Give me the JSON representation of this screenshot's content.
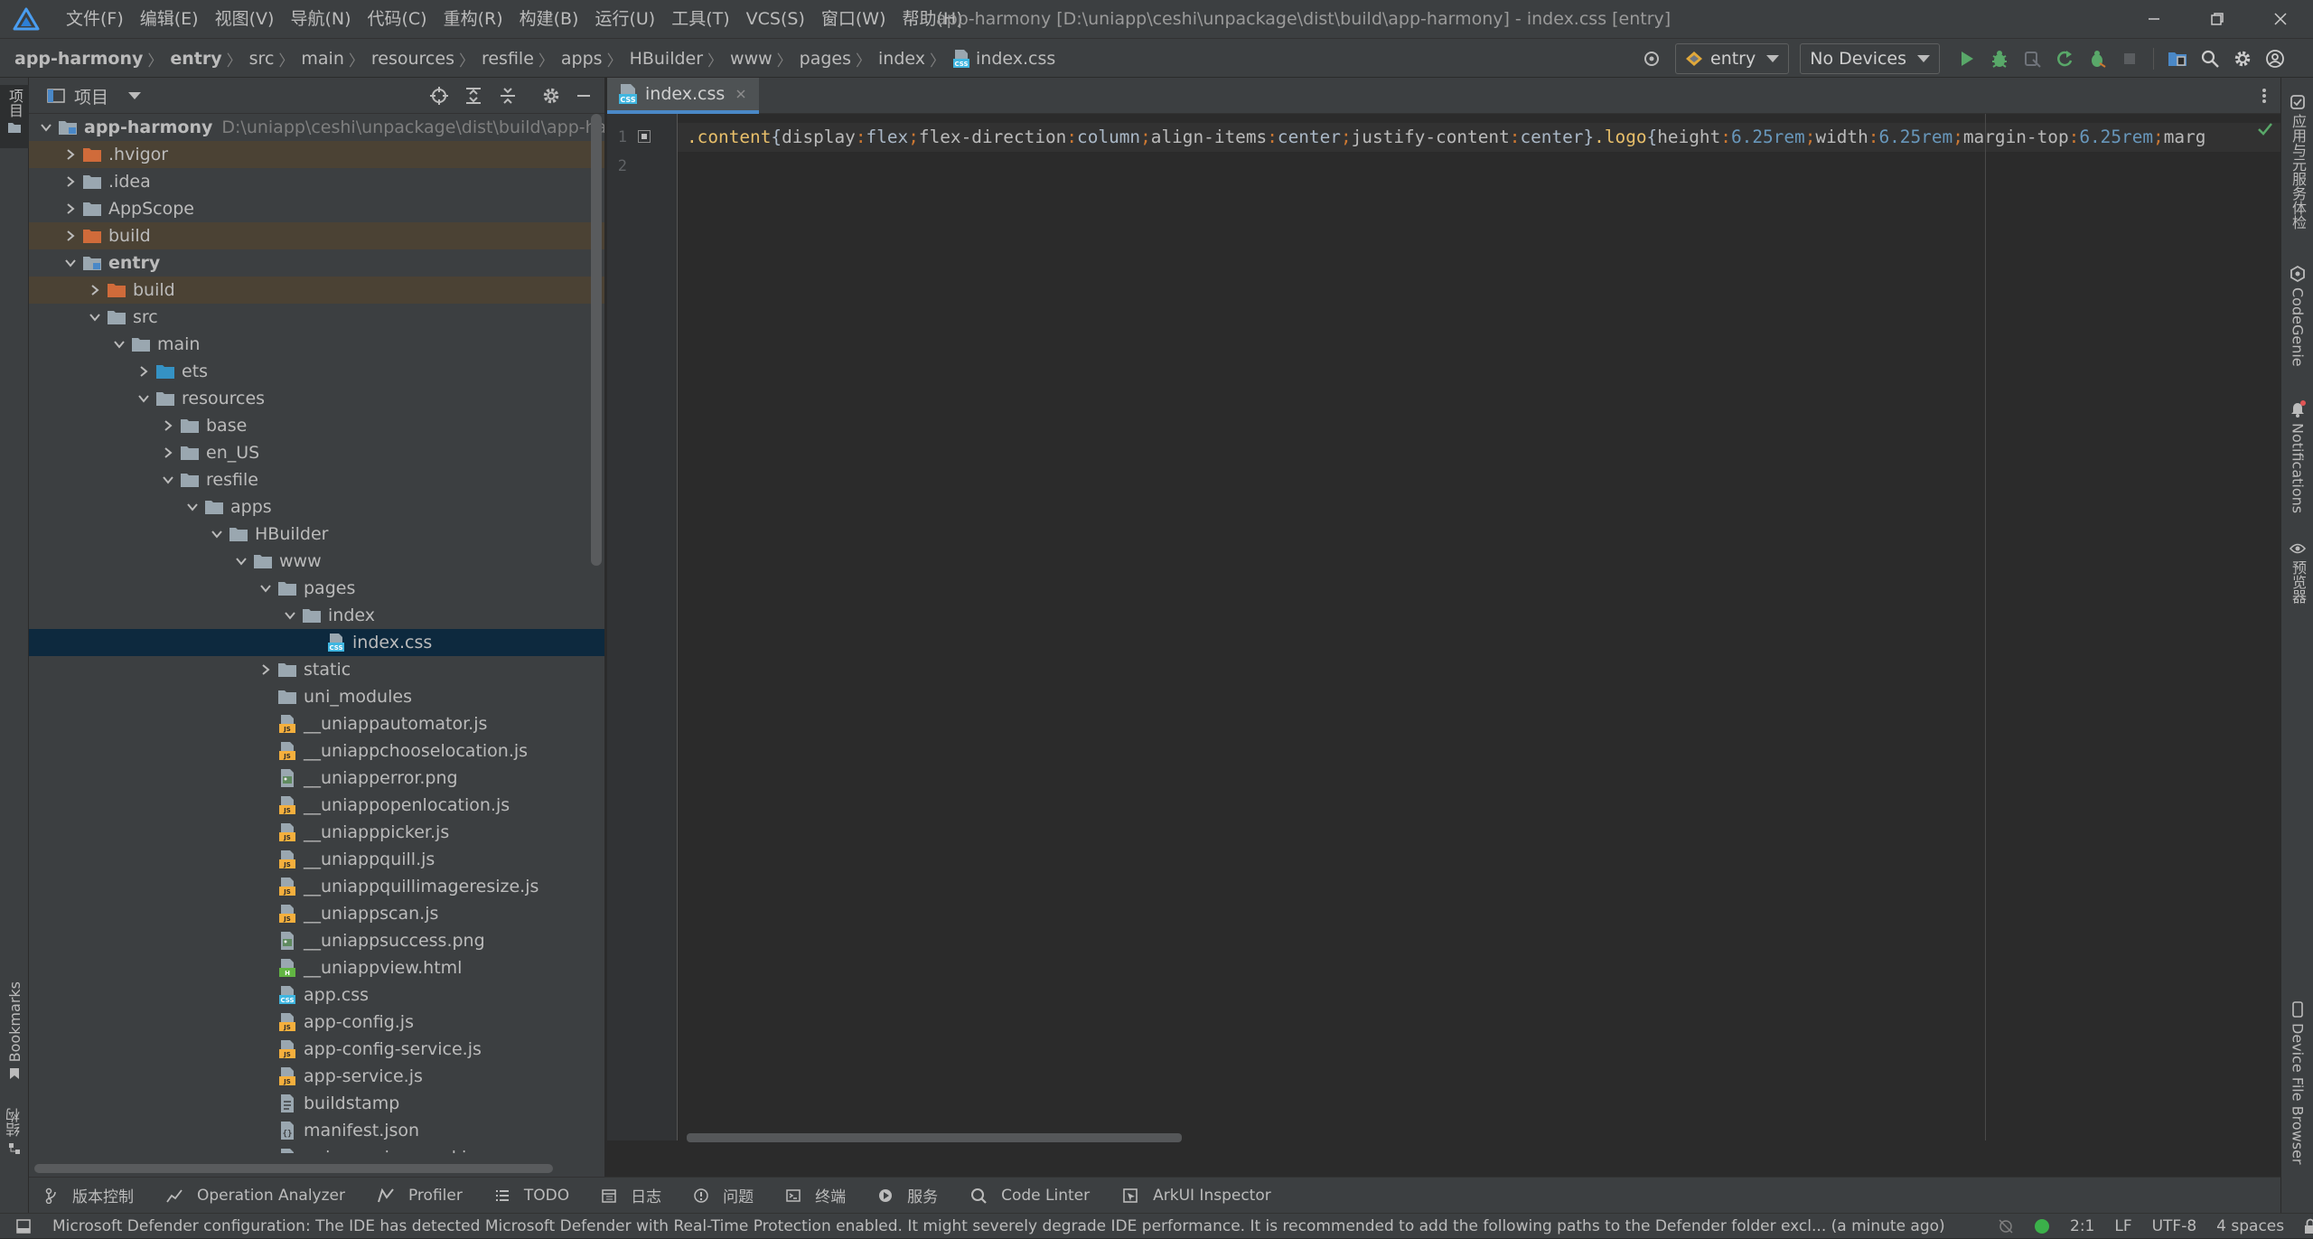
{
  "menubar": {
    "items": [
      "文件(F)",
      "编辑(E)",
      "视图(V)",
      "导航(N)",
      "代码(C)",
      "重构(R)",
      "构建(B)",
      "运行(U)",
      "工具(T)",
      "VCS(S)",
      "窗口(W)",
      "帮助(H)"
    ],
    "window_title": "app-harmony [D:\\uniapp\\ceshi\\unpackage\\dist\\build\\app-harmony] - index.css [entry]"
  },
  "breadcrumbs": [
    "app-harmony",
    "entry",
    "src",
    "main",
    "resources",
    "resfile",
    "apps",
    "HBuilder",
    "www",
    "pages",
    "index",
    "index.css"
  ],
  "run": {
    "config": "entry",
    "device": "No Devices",
    "icons": [
      "crosshair-icon",
      "run-icon",
      "debug-icon",
      "attach-icon",
      "restart-icon",
      "profile-icon",
      "stop-icon",
      "device-manager-icon",
      "search-icon",
      "settings-icon",
      "account-icon"
    ]
  },
  "left_strip": {
    "project_label": "项目",
    "bookmarks_label": "Bookmarks",
    "structure_label": "结构"
  },
  "project_panel": {
    "title": "项目",
    "tree": [
      {
        "label": "app-harmony",
        "hint": "D:\\uniapp\\ceshi\\unpackage\\dist\\build\\app-harmony",
        "depth": 0,
        "expanded": true,
        "icon": "module-folder",
        "bold": true
      },
      {
        "label": ".hvigor",
        "depth": 1,
        "expanded": false,
        "icon": "folder-excluded",
        "excluded": true
      },
      {
        "label": ".idea",
        "depth": 1,
        "expanded": false,
        "icon": "folder"
      },
      {
        "label": "AppScope",
        "depth": 1,
        "expanded": false,
        "icon": "folder"
      },
      {
        "label": "build",
        "depth": 1,
        "expanded": false,
        "icon": "folder-excluded",
        "excluded": true
      },
      {
        "label": "entry",
        "depth": 1,
        "expanded": true,
        "icon": "module-folder",
        "bold": true
      },
      {
        "label": "build",
        "depth": 2,
        "expanded": false,
        "icon": "folder-excluded",
        "excluded": true
      },
      {
        "label": "src",
        "depth": 2,
        "expanded": true,
        "icon": "folder"
      },
      {
        "label": "main",
        "depth": 3,
        "expanded": true,
        "icon": "folder"
      },
      {
        "label": "ets",
        "depth": 4,
        "expanded": false,
        "icon": "folder-source"
      },
      {
        "label": "resources",
        "depth": 4,
        "expanded": true,
        "icon": "folder"
      },
      {
        "label": "base",
        "depth": 5,
        "expanded": false,
        "icon": "folder"
      },
      {
        "label": "en_US",
        "depth": 5,
        "expanded": false,
        "icon": "folder"
      },
      {
        "label": "resfile",
        "depth": 5,
        "expanded": true,
        "icon": "folder"
      },
      {
        "label": "apps",
        "depth": 6,
        "expanded": true,
        "icon": "folder"
      },
      {
        "label": "HBuilder",
        "depth": 7,
        "expanded": true,
        "icon": "folder"
      },
      {
        "label": "www",
        "depth": 8,
        "expanded": true,
        "icon": "folder"
      },
      {
        "label": "pages",
        "depth": 9,
        "expanded": true,
        "icon": "folder"
      },
      {
        "label": "index",
        "depth": 10,
        "expanded": true,
        "icon": "folder"
      },
      {
        "label": "index.css",
        "depth": 11,
        "icon": "css-file",
        "selected": true
      },
      {
        "label": "static",
        "depth": 9,
        "expanded": false,
        "icon": "folder"
      },
      {
        "label": "uni_modules",
        "depth": 9,
        "icon": "folder"
      },
      {
        "label": "__uniappautomator.js",
        "depth": 9,
        "icon": "js-file"
      },
      {
        "label": "__uniappchooselocation.js",
        "depth": 9,
        "icon": "js-file"
      },
      {
        "label": "__uniapperror.png",
        "depth": 9,
        "icon": "image-file"
      },
      {
        "label": "__uniappopenlocation.js",
        "depth": 9,
        "icon": "js-file"
      },
      {
        "label": "__uniapppicker.js",
        "depth": 9,
        "icon": "js-file"
      },
      {
        "label": "__uniappquill.js",
        "depth": 9,
        "icon": "js-file"
      },
      {
        "label": "__uniappquillimageresize.js",
        "depth": 9,
        "icon": "js-file"
      },
      {
        "label": "__uniappscan.js",
        "depth": 9,
        "icon": "js-file"
      },
      {
        "label": "__uniappsuccess.png",
        "depth": 9,
        "icon": "image-file"
      },
      {
        "label": "__uniappview.html",
        "depth": 9,
        "icon": "html-file"
      },
      {
        "label": "app.css",
        "depth": 9,
        "icon": "css-file"
      },
      {
        "label": "app-config.js",
        "depth": 9,
        "icon": "js-file"
      },
      {
        "label": "app-config-service.js",
        "depth": 9,
        "icon": "js-file"
      },
      {
        "label": "app-service.js",
        "depth": 9,
        "icon": "js-file"
      },
      {
        "label": "buildstamp",
        "depth": 9,
        "icon": "text-file"
      },
      {
        "label": "manifest.json",
        "depth": 9,
        "icon": "json-file"
      },
      {
        "label": "uni-app-view.umd.js",
        "depth": 9,
        "icon": "js-file"
      }
    ]
  },
  "editor": {
    "tab_label": "index.css",
    "line_numbers": [
      "1",
      "2"
    ],
    "code_tokens": [
      {
        "t": ".content",
        "c": "#e8bf6a"
      },
      {
        "t": "{",
        "c": "#a9b7c6"
      },
      {
        "t": "display",
        "c": "#bababa"
      },
      {
        "t": ":",
        "c": "#cc7832"
      },
      {
        "t": "flex",
        "c": "#a9b7c6"
      },
      {
        "t": ";",
        "c": "#cc7832"
      },
      {
        "t": "flex-direction",
        "c": "#bababa"
      },
      {
        "t": ":",
        "c": "#cc7832"
      },
      {
        "t": "column",
        "c": "#a9b7c6"
      },
      {
        "t": ";",
        "c": "#cc7832"
      },
      {
        "t": "align-items",
        "c": "#bababa"
      },
      {
        "t": ":",
        "c": "#cc7832"
      },
      {
        "t": "center",
        "c": "#a9b7c6"
      },
      {
        "t": ";",
        "c": "#cc7832"
      },
      {
        "t": "justify-content",
        "c": "#bababa"
      },
      {
        "t": ":",
        "c": "#cc7832"
      },
      {
        "t": "center",
        "c": "#a9b7c6"
      },
      {
        "t": "}",
        "c": "#a9b7c6"
      },
      {
        "t": ".logo",
        "c": "#e8bf6a"
      },
      {
        "t": "{",
        "c": "#a9b7c6"
      },
      {
        "t": "height",
        "c": "#bababa"
      },
      {
        "t": ":",
        "c": "#cc7832"
      },
      {
        "t": "6.25",
        "c": "#6897bb"
      },
      {
        "t": "rem",
        "c": "#6897bb"
      },
      {
        "t": ";",
        "c": "#cc7832"
      },
      {
        "t": "width",
        "c": "#bababa"
      },
      {
        "t": ":",
        "c": "#cc7832"
      },
      {
        "t": "6.25",
        "c": "#6897bb"
      },
      {
        "t": "rem",
        "c": "#6897bb"
      },
      {
        "t": ";",
        "c": "#cc7832"
      },
      {
        "t": "margin-top",
        "c": "#bababa"
      },
      {
        "t": ":",
        "c": "#cc7832"
      },
      {
        "t": "6.25",
        "c": "#6897bb"
      },
      {
        "t": "rem",
        "c": "#6897bb"
      },
      {
        "t": ";",
        "c": "#cc7832"
      },
      {
        "t": "marg",
        "c": "#bababa"
      }
    ]
  },
  "right_strip": {
    "items": [
      "应用与元服务体检",
      "CodeGenie",
      "Notifications",
      "预览器",
      "Device File Browser"
    ]
  },
  "tool_windows": [
    {
      "label": "版本控制",
      "icon": "vcs-branch-icon"
    },
    {
      "label": "Operation Analyzer",
      "icon": "analyzer-chart-icon"
    },
    {
      "label": "Profiler",
      "icon": "profiler-icon"
    },
    {
      "label": "TODO",
      "icon": "todo-list-icon"
    },
    {
      "label": "日志",
      "icon": "log-icon"
    },
    {
      "label": "问题",
      "icon": "problems-icon"
    },
    {
      "label": "终端",
      "icon": "terminal-icon"
    },
    {
      "label": "服务",
      "icon": "services-icon"
    },
    {
      "label": "Code Linter",
      "icon": "code-linter-icon"
    },
    {
      "label": "ArkUI Inspector",
      "icon": "arkui-inspector-icon"
    }
  ],
  "status": {
    "message": "Microsoft Defender configuration: The IDE has detected Microsoft Defender with Real-Time Protection enabled. It might severely degrade IDE performance. It is recommended to add the following paths to the Defender folder excl... (a minute ago)",
    "position": "2:1",
    "line_separator": "LF",
    "encoding": "UTF-8",
    "indent": "4 spaces"
  },
  "colors": {
    "accent": "#4a88c7",
    "excluded_bg": "#4b4234",
    "selected_bg": "#0d293e",
    "run_green": "#59a869"
  }
}
